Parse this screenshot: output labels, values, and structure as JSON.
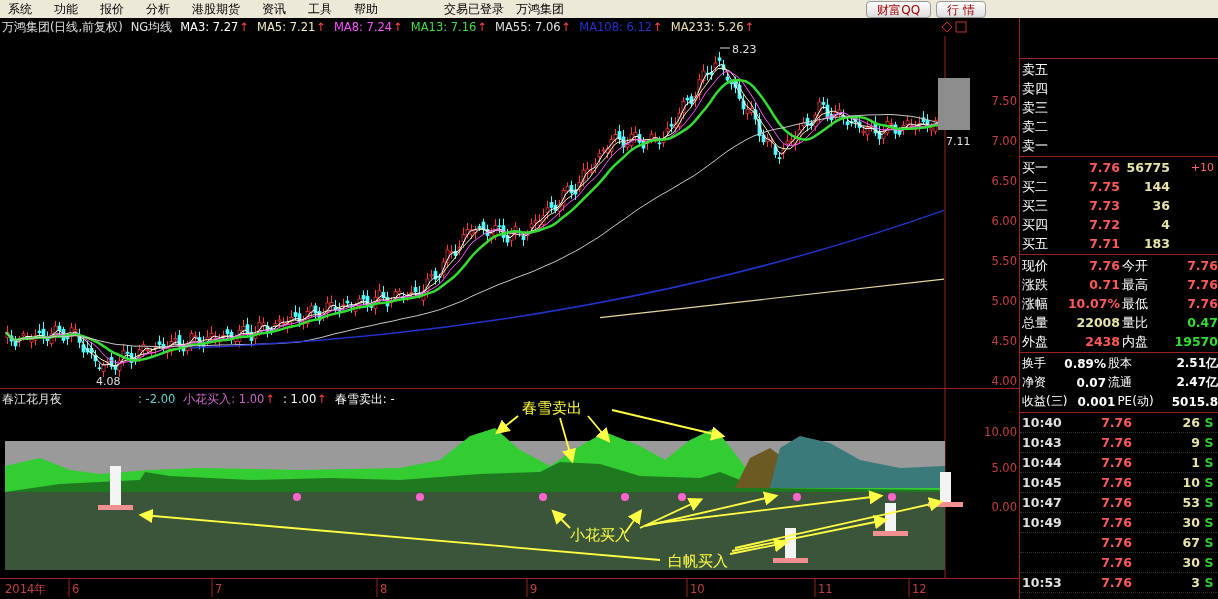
{
  "menu_bar": {
    "items": [
      "系统",
      "功能",
      "报价",
      "分析",
      "港股期货",
      "资讯",
      "工具",
      "帮助"
    ],
    "status": "交易已登录",
    "stock_name": "万鸿集团",
    "buttons": [
      "财富QQ",
      "行 情"
    ]
  },
  "main_chart": {
    "title": "万鸿集团(日线,前复权)",
    "indicator": "NG均线",
    "legend": [
      {
        "label": "MA3: 7.27",
        "arrow": "↑",
        "color": "#ffffff"
      },
      {
        "label": "MA5: 7.21",
        "arrow": "↑",
        "color": "#f4f0c0"
      },
      {
        "label": "MA8: 7.24",
        "arrow": "↑",
        "color": "#ff55ff"
      },
      {
        "label": "MA13: 7.16",
        "arrow": "↑",
        "color": "#44dd44"
      },
      {
        "label": "MA55: 7.06",
        "arrow": "↑",
        "color": "#e0e0e0"
      },
      {
        "label": "MA108: 6.12",
        "arrow": "↑",
        "color": "#2233cc"
      },
      {
        "label": "MA233: 5.26",
        "arrow": "↑",
        "color": "#f0e0b0"
      }
    ],
    "price_ticks": [
      "7.50",
      "7.00",
      "6.50",
      "6.00",
      "5.50",
      "5.00",
      "4.50",
      "4.00"
    ],
    "high_label": "8.23",
    "low_label": "4.08",
    "last_label": "7.11"
  },
  "indicator_chart": {
    "title": "春江花月夜",
    "legend": [
      {
        "label": ": -2.00",
        "color": "#66cccc"
      },
      {
        "label": "小花买入: 1.00",
        "arrow": "↑",
        "color": "#cc66cc"
      },
      {
        "label": ": 1.00",
        "arrow": "↑"
      },
      {
        "label": "春雪卖出: -"
      }
    ],
    "ticks": [
      "10.00",
      "5.00",
      "0.00"
    ],
    "annotations": [
      {
        "text": "春雪卖出",
        "kind": "sell"
      },
      {
        "text": "小花买入",
        "kind": "flower"
      },
      {
        "text": "白帆买入",
        "kind": "sail"
      }
    ]
  },
  "x_axis": [
    "2014年",
    "6",
    "7",
    "8",
    "9",
    "10",
    "11",
    "12"
  ],
  "order_book": {
    "sell": [
      {
        "label": "卖五"
      },
      {
        "label": "卖四"
      },
      {
        "label": "卖三"
      },
      {
        "label": "卖二"
      },
      {
        "label": "卖一"
      }
    ],
    "buy": [
      {
        "label": "买一",
        "price": "7.76",
        "volume": "56775",
        "change": "+10"
      },
      {
        "label": "买二",
        "price": "7.75",
        "volume": "144"
      },
      {
        "label": "买三",
        "price": "7.73",
        "volume": "36"
      },
      {
        "label": "买四",
        "price": "7.72",
        "volume": "4"
      },
      {
        "label": "买五",
        "price": "7.71",
        "volume": "183"
      }
    ]
  },
  "quote": [
    {
      "cells": [
        {
          "label": "现价",
          "value": "7.76",
          "color": "#ff5a5a"
        },
        {
          "label": "今开",
          "value": "7.76",
          "color": "#ff5a5a"
        }
      ]
    },
    {
      "cells": [
        {
          "label": "涨跌",
          "value": "0.71",
          "color": "#ff5a5a"
        },
        {
          "label": "最高",
          "value": "7.76",
          "color": "#ff5a5a"
        }
      ]
    },
    {
      "cells": [
        {
          "label": "涨幅",
          "value": "10.07%",
          "color": "#ff5a5a"
        },
        {
          "label": "最低",
          "value": "7.76",
          "color": "#ff5a5a"
        }
      ]
    },
    {
      "cells": [
        {
          "label": "总量",
          "value": "22008",
          "color": "#e8e4a8"
        },
        {
          "label": "量比",
          "value": "0.47",
          "color": "#33dd33"
        }
      ]
    },
    {
      "cells": [
        {
          "label": "外盘",
          "value": "2438",
          "color": "#ff5a5a"
        },
        {
          "label": "内盘",
          "value": "19570",
          "color": "#33dd33"
        }
      ]
    }
  ],
  "info": [
    {
      "label": "换手",
      "value": "0.89%",
      "label2": "股本",
      "value2": "2.51亿"
    },
    {
      "label": "净资",
      "value": "0.07",
      "label2": "流通",
      "value2": "2.47亿"
    },
    {
      "label": "收益(三)",
      "value": "0.001",
      "label2": "PE(动)",
      "value2": "5015.8"
    }
  ],
  "trades": [
    {
      "time": "10:40",
      "price": "7.76",
      "volume": "26",
      "side": "S"
    },
    {
      "time": "10:43",
      "price": "7.76",
      "volume": "9",
      "side": "S"
    },
    {
      "time": "10:44",
      "price": "7.76",
      "volume": "1",
      "side": "S"
    },
    {
      "time": "10:45",
      "price": "7.76",
      "volume": "10",
      "side": "S"
    },
    {
      "time": "10:47",
      "price": "7.76",
      "volume": "53",
      "side": "S"
    },
    {
      "time": "10:49",
      "price": "7.76",
      "volume": "30",
      "side": "S"
    },
    {
      "price": "7.76",
      "volume": "67",
      "side": "S"
    },
    {
      "price": "7.76",
      "volume": "30",
      "side": "S"
    },
    {
      "time": "10:53",
      "price": "7.76",
      "volume": "3",
      "side": "S"
    }
  ]
}
